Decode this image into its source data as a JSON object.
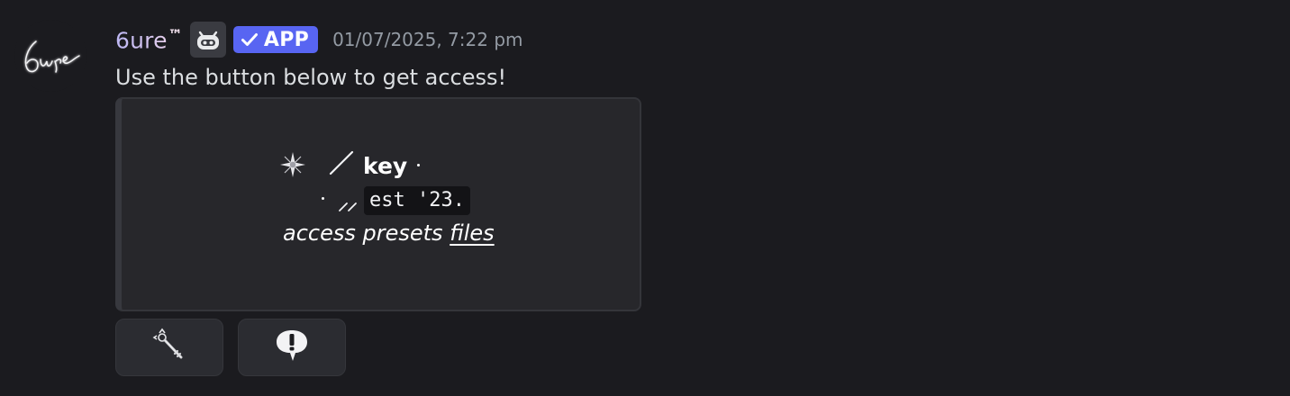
{
  "author": {
    "name": "6ure",
    "name_suffix": "™",
    "avatar_text": "6ure",
    "bot_icon": "bot-face-icon",
    "tag": {
      "label": "APP",
      "icon": "checkmark-icon",
      "color": "#5865f2"
    },
    "timestamp": "01/07/2025, 7:22 pm"
  },
  "message": {
    "text": "Use the button below to get access!"
  },
  "container": {
    "title_icon": "sparkle-star-icon",
    "title_divider": "/",
    "title": "key",
    "subtitle_divider": "//",
    "subtitle_code": "est '23.",
    "line3_text": "access presets",
    "line3_link": "files"
  },
  "buttons": [
    {
      "icon": "key-emoji-icon",
      "name": "key-button"
    },
    {
      "icon": "exclamation-bubble-icon",
      "name": "alert-button"
    }
  ],
  "colors": {
    "background": "#1b1b1f",
    "container_bg": "#27272b",
    "button_bg": "#2b2c31",
    "timestamp": "#949ba4",
    "accent": "#5865f2"
  }
}
